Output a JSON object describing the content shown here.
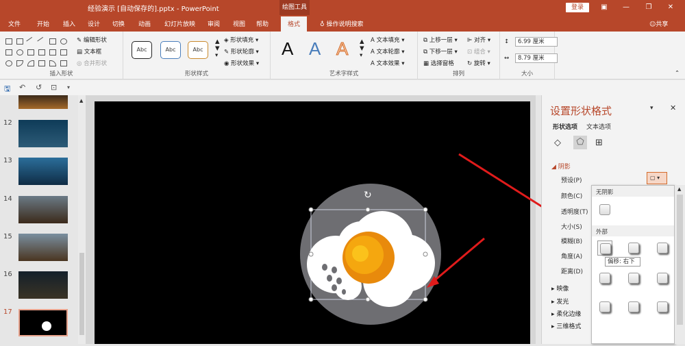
{
  "titlebar": {
    "title": "经验演示 [自动保存的].pptx - PowerPoint",
    "context_tab": "绘图工具",
    "login": "登录",
    "bg": "#b7472a"
  },
  "tabs": [
    "文件",
    "开始",
    "插入",
    "设计",
    "切换",
    "动画",
    "幻灯片放映",
    "审阅",
    "视图",
    "帮助",
    "格式"
  ],
  "tell_me": "操作说明搜索",
  "share": "共享",
  "ribbon": {
    "insert_shapes": {
      "edit_shape": "编辑形状",
      "text_box": "文本框",
      "merge_shapes": "合并形状",
      "name": "插入形状"
    },
    "shape_styles": {
      "abc": "Abc",
      "fill": "形状填充",
      "outline": "形状轮廓",
      "effects": "形状效果",
      "name": "形状样式"
    },
    "wordart": {
      "a": "A",
      "text_fill": "文本填充",
      "text_outline": "文本轮廓",
      "text_effects": "文本效果",
      "name": "艺术字样式"
    },
    "arrange": {
      "bring_forward": "上移一层",
      "send_backward": "下移一层",
      "selection_pane": "选择窗格",
      "align": "对齐",
      "group": "组合",
      "rotate": "旋转",
      "name": "排列"
    },
    "size": {
      "height": "6.99 厘米",
      "width": "8.79 厘米",
      "name": "大小"
    }
  },
  "slides": [
    {
      "num": "12"
    },
    {
      "num": "13"
    },
    {
      "num": "14"
    },
    {
      "num": "15"
    },
    {
      "num": "16"
    },
    {
      "num": "17"
    }
  ],
  "panel": {
    "title": "设置形状格式",
    "tab_shape": "形状选项",
    "tab_text": "文本选项",
    "section_shadow": "阴影",
    "rows": [
      "预设(P)",
      "颜色(C)",
      "透明度(T)",
      "大小(S)",
      "模糊(B)",
      "角度(A)",
      "距离(D)"
    ],
    "sections": [
      "映像",
      "发光",
      "柔化边缘",
      "三维格式"
    ]
  },
  "dropdown": {
    "no_shadow": "无阴影",
    "outer": "外部",
    "tooltip": "偏移: 右下"
  }
}
